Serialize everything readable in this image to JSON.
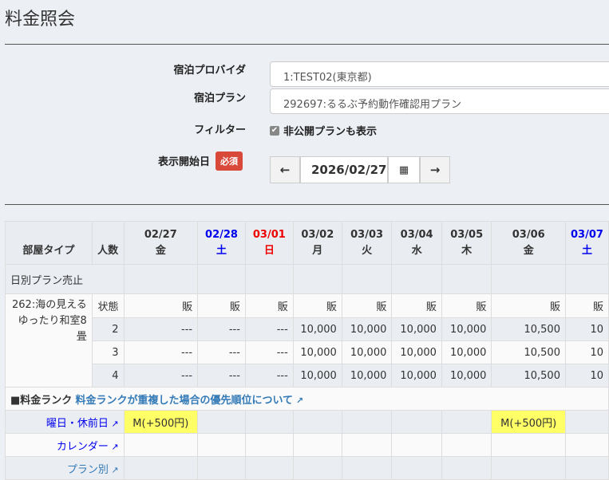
{
  "page_title": "料金照会",
  "form": {
    "provider_label": "宿泊プロバイダ",
    "provider_value": "1:TEST02(東京都)",
    "plan_label": "宿泊プラン",
    "plan_value": "292697:るるぶ予約動作確認用プラン",
    "filter_label": "フィルター",
    "filter_checkbox": "非公開プランも表示",
    "filter_checked": true,
    "start_label": "表示開始日",
    "required_badge": "必須",
    "date_value": "2026/02/27"
  },
  "table": {
    "room_type_header": "部屋タイプ",
    "persons_header": "人数",
    "dates": [
      {
        "date": "02/27",
        "dow": "金",
        "color": "normal"
      },
      {
        "date": "02/28",
        "dow": "土",
        "color": "blue"
      },
      {
        "date": "03/01",
        "dow": "日",
        "color": "red"
      },
      {
        "date": "03/02",
        "dow": "月",
        "color": "normal"
      },
      {
        "date": "03/03",
        "dow": "火",
        "color": "normal"
      },
      {
        "date": "03/04",
        "dow": "水",
        "color": "normal"
      },
      {
        "date": "03/05",
        "dow": "木",
        "color": "normal"
      },
      {
        "date": "03/06",
        "dow": "金",
        "color": "normal"
      },
      {
        "date": "03/07",
        "dow": "土",
        "color": "blue"
      }
    ],
    "daily_stop_label": "日別プラン売止",
    "room_name": "262:海の見える ゆったり和室8畳",
    "status_label": "状態",
    "status": [
      "販",
      "販",
      "販",
      "販",
      "販",
      "販",
      "販",
      "販",
      "販"
    ],
    "rows": [
      {
        "persons": "2",
        "values": [
          "---",
          "---",
          "---",
          "10,000",
          "10,000",
          "10,000",
          "10,000",
          "10,500",
          "10"
        ]
      },
      {
        "persons": "3",
        "values": [
          "---",
          "---",
          "---",
          "10,000",
          "10,000",
          "10,000",
          "10,000",
          "10,500",
          "10"
        ]
      },
      {
        "persons": "4",
        "values": [
          "---",
          "---",
          "---",
          "10,000",
          "10,000",
          "10,000",
          "10,000",
          "10,500",
          "10"
        ]
      }
    ],
    "rank_title": "■料金ランク",
    "rank_link": "料金ランクが重複した場合の優先順位について",
    "rank_rows": [
      {
        "label": "曜日・休前日",
        "cells": [
          "M(+500円)",
          "",
          "",
          "",
          "",
          "",
          "",
          "M(+500円)",
          ""
        ]
      },
      {
        "label": "カレンダー",
        "cells": [
          "",
          "",
          "",
          "",
          "",
          "",
          "",
          "",
          ""
        ]
      },
      {
        "label": "プラン別",
        "cells": [
          "",
          "",
          "",
          "",
          "",
          "",
          "",
          "",
          ""
        ]
      }
    ]
  }
}
